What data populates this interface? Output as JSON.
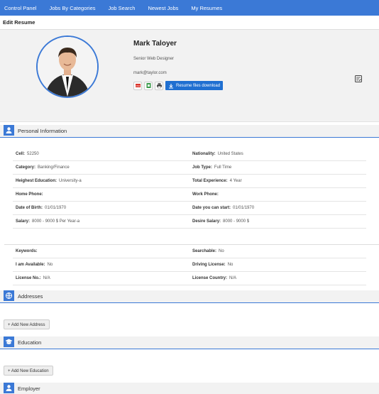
{
  "nav": {
    "items": [
      "Control Panel",
      "Jobs By Categories",
      "Job Search",
      "Newest Jobs",
      "My Resumes"
    ]
  },
  "page": {
    "title": "Edit Resume"
  },
  "profile": {
    "name": "Mark Taloyer",
    "title": "Senior Web Designer",
    "email": "mark@taylor.com",
    "download_label": "Resume files download"
  },
  "sections": {
    "personal": "Personal Information",
    "addresses": "Addresses",
    "education": "Education",
    "employer": "Employer"
  },
  "personal_rows": [
    [
      {
        "label": "Cell:",
        "value": "52250"
      },
      {
        "label": "Nationality:",
        "value": "United States"
      }
    ],
    [
      {
        "label": "Category:",
        "value": "Banking/Finance"
      },
      {
        "label": "Job Type:",
        "value": "Full Time"
      }
    ],
    [
      {
        "label": "Heighest Education:",
        "value": "University-a"
      },
      {
        "label": "Total Experience:",
        "value": "4 Year"
      }
    ],
    [
      {
        "label": "Home Phone:",
        "value": ""
      },
      {
        "label": "Work Phone:",
        "value": ""
      }
    ],
    [
      {
        "label": "Date of Birth:",
        "value": "01/01/1970"
      },
      {
        "label": "Date you can start:",
        "value": "01/01/1970"
      }
    ],
    [
      {
        "label": "Salary:",
        "value": "8000 - 9000 $ Per Year-a"
      },
      {
        "label": "Desire Salary:",
        "value": "8000 - 9000 $"
      }
    ]
  ],
  "extra_rows": [
    [
      {
        "label": "Keywords:",
        "value": ""
      },
      {
        "label": "Searchable:",
        "value": "No"
      }
    ],
    [
      {
        "label": "I am Available:",
        "value": "No"
      },
      {
        "label": "Driving License:",
        "value": "No"
      }
    ],
    [
      {
        "label": "License No.:",
        "value": "N/A"
      },
      {
        "label": "License Country:",
        "value": "N/A"
      }
    ]
  ],
  "buttons": {
    "add_address": "+ Add New Address",
    "add_education": "+ Add New Education"
  },
  "colors": {
    "accent": "#3b79d6",
    "download": "#1f6fd1"
  },
  "icons": [
    "pdf-icon",
    "excel-icon",
    "print-icon",
    "download-icon",
    "edit-icon",
    "user-icon",
    "address-icon",
    "education-icon",
    "employer-icon"
  ]
}
